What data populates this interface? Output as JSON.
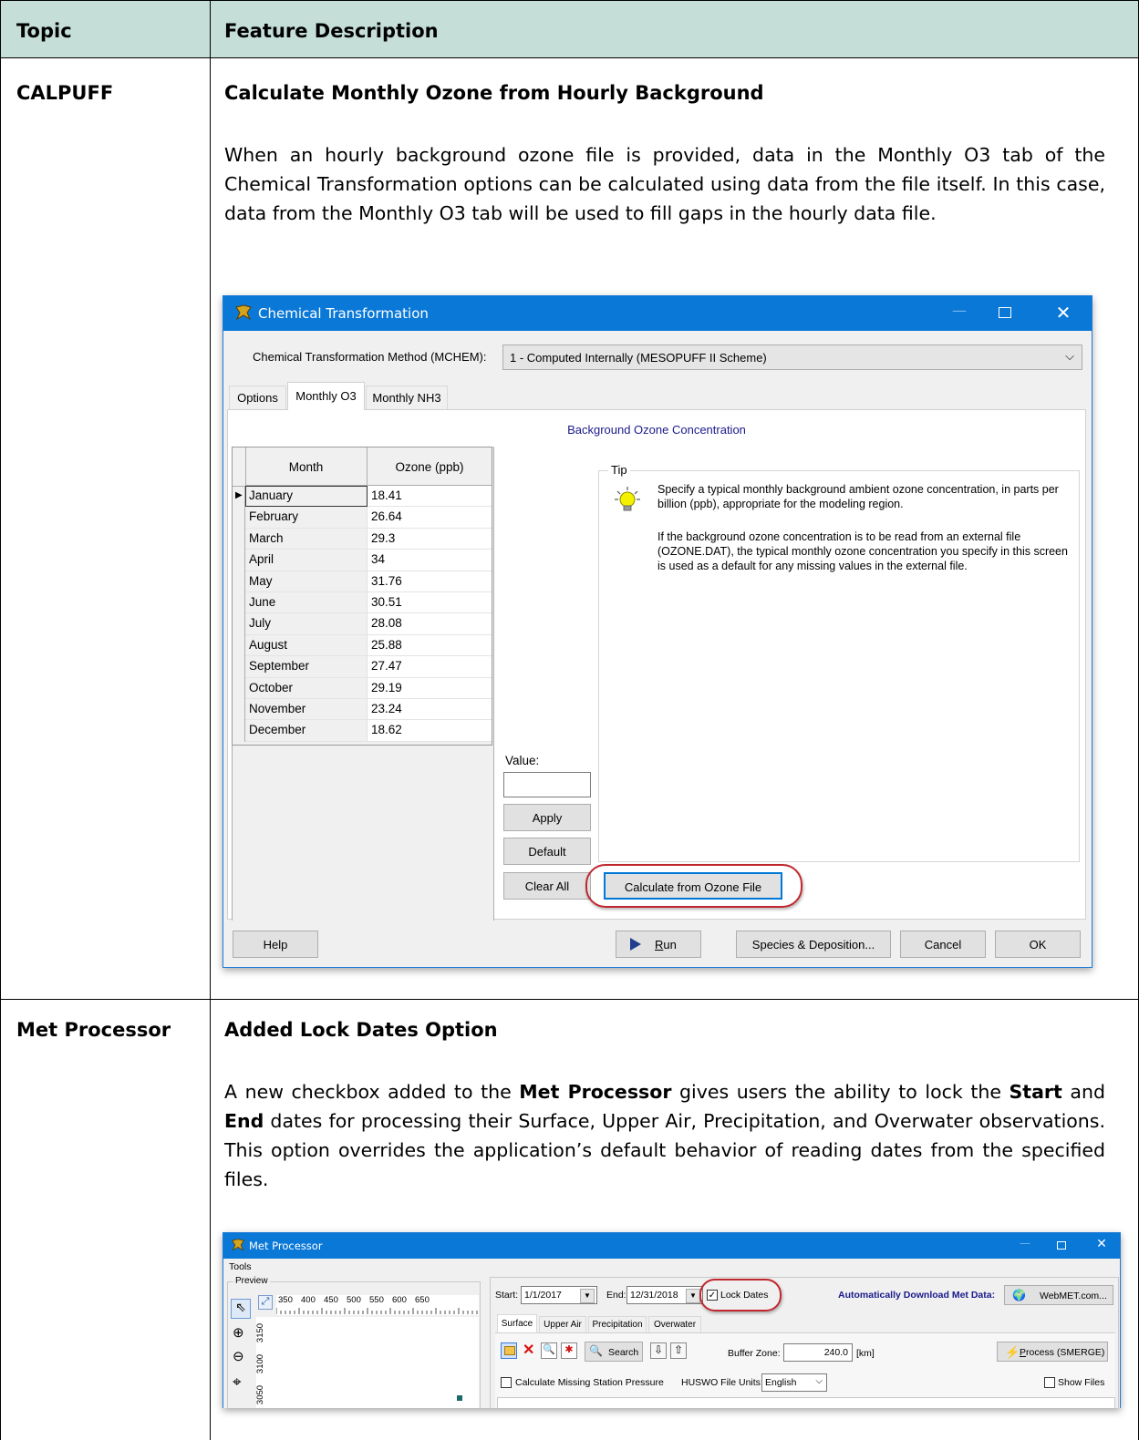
{
  "table": {
    "header": {
      "topic": "Topic",
      "feature": "Feature Description"
    },
    "rows": [
      {
        "topic": "CALPUFF",
        "heading": "Calculate Monthly Ozone from Hourly Background",
        "paragraph": "When an hourly background ozone file is provided, data in the Monthly O3 tab of the Chemical Transformation options can be calculated using data from the file itself. In this case, data from the Monthly O3 tab will be used to fill gaps in the hourly data file."
      },
      {
        "topic": "Met Processor",
        "heading": "Added Lock Dates Option",
        "paragraph_parts": {
          "p1": "A new checkbox added to the ",
          "b1": "Met Processor",
          "p2": " gives users the ability to lock the ",
          "b2": "Start",
          "p3": " and ",
          "b3": "End",
          "p4": " dates for processing their Surface, Upper Air, Precipitation, and Overwater observations.  This option overrides the application’s default behavior of reading dates from the specified files."
        }
      }
    ]
  },
  "chem_dialog": {
    "title": "Chemical Transformation",
    "method_label": "Chemical Transformation Method (MCHEM):",
    "method_value": "1 - Computed Internally (MESOPUFF II Scheme)",
    "tabs": [
      "Options",
      "Monthly O3",
      "Monthly NH3"
    ],
    "active_tab": "Monthly O3",
    "section_title": "Background Ozone Concentration",
    "grid_headers": [
      "Month",
      "Ozone (ppb)"
    ],
    "months": [
      {
        "month": "January",
        "ozone": "18.41"
      },
      {
        "month": "February",
        "ozone": "26.64"
      },
      {
        "month": "March",
        "ozone": "29.3"
      },
      {
        "month": "April",
        "ozone": "34"
      },
      {
        "month": "May",
        "ozone": "31.76"
      },
      {
        "month": "June",
        "ozone": "30.51"
      },
      {
        "month": "July",
        "ozone": "28.08"
      },
      {
        "month": "August",
        "ozone": "25.88"
      },
      {
        "month": "September",
        "ozone": "27.47"
      },
      {
        "month": "October",
        "ozone": "29.19"
      },
      {
        "month": "November",
        "ozone": "23.24"
      },
      {
        "month": "December",
        "ozone": "18.62"
      }
    ],
    "tip_title": "Tip",
    "tip_p1": "Specify a typical monthly background ambient ozone concentration, in parts per billion (ppb), appropriate for the modeling region.",
    "tip_p2": "If the background ozone concentration is to be read from an external file (OZONE.DAT), the typical monthly ozone concentration you specify in this screen is used as a default for any missing values in the external file.",
    "value_label": "Value:",
    "value": "",
    "apply": "Apply",
    "default": "Default",
    "clear_all": "Clear All",
    "calc_from_file": "Calculate from Ozone File",
    "help": "Help",
    "run_prefix": "R",
    "run_rest": "un",
    "species": "Species & Deposition...",
    "cancel": "Cancel",
    "ok": "OK",
    "highlight_color": "#c0272d"
  },
  "met_dialog": {
    "title": "Met Processor",
    "menu": "Tools",
    "preview_label": "Preview",
    "ruler_x": [
      "350",
      "400",
      "450",
      "500",
      "550",
      "600",
      "650"
    ],
    "ruler_y": [
      "3150",
      "3100",
      "3050"
    ],
    "start_label": "Start:",
    "start_value": "1/1/2017",
    "end_label": "End:",
    "end_value": "12/31/2018",
    "lock_dates": "Lock Dates",
    "lock_checked": true,
    "auto_download": "Automatically Download Met Data:",
    "webmet": "WebMET.com...",
    "tabs": [
      "Surface",
      "Upper Air",
      "Precipitation",
      "Overwater"
    ],
    "search": "Search",
    "buffer_label": "Buffer Zone:",
    "buffer_value": "240.0",
    "buffer_unit": "[km]",
    "process_prefix": "P",
    "process_rest": "rocess (SMERGE)",
    "calc_missing": "Calculate Missing Station Pressure",
    "huswo_label": "HUSWO File Units:",
    "huswo_value": "English",
    "show_files": "Show Files"
  }
}
